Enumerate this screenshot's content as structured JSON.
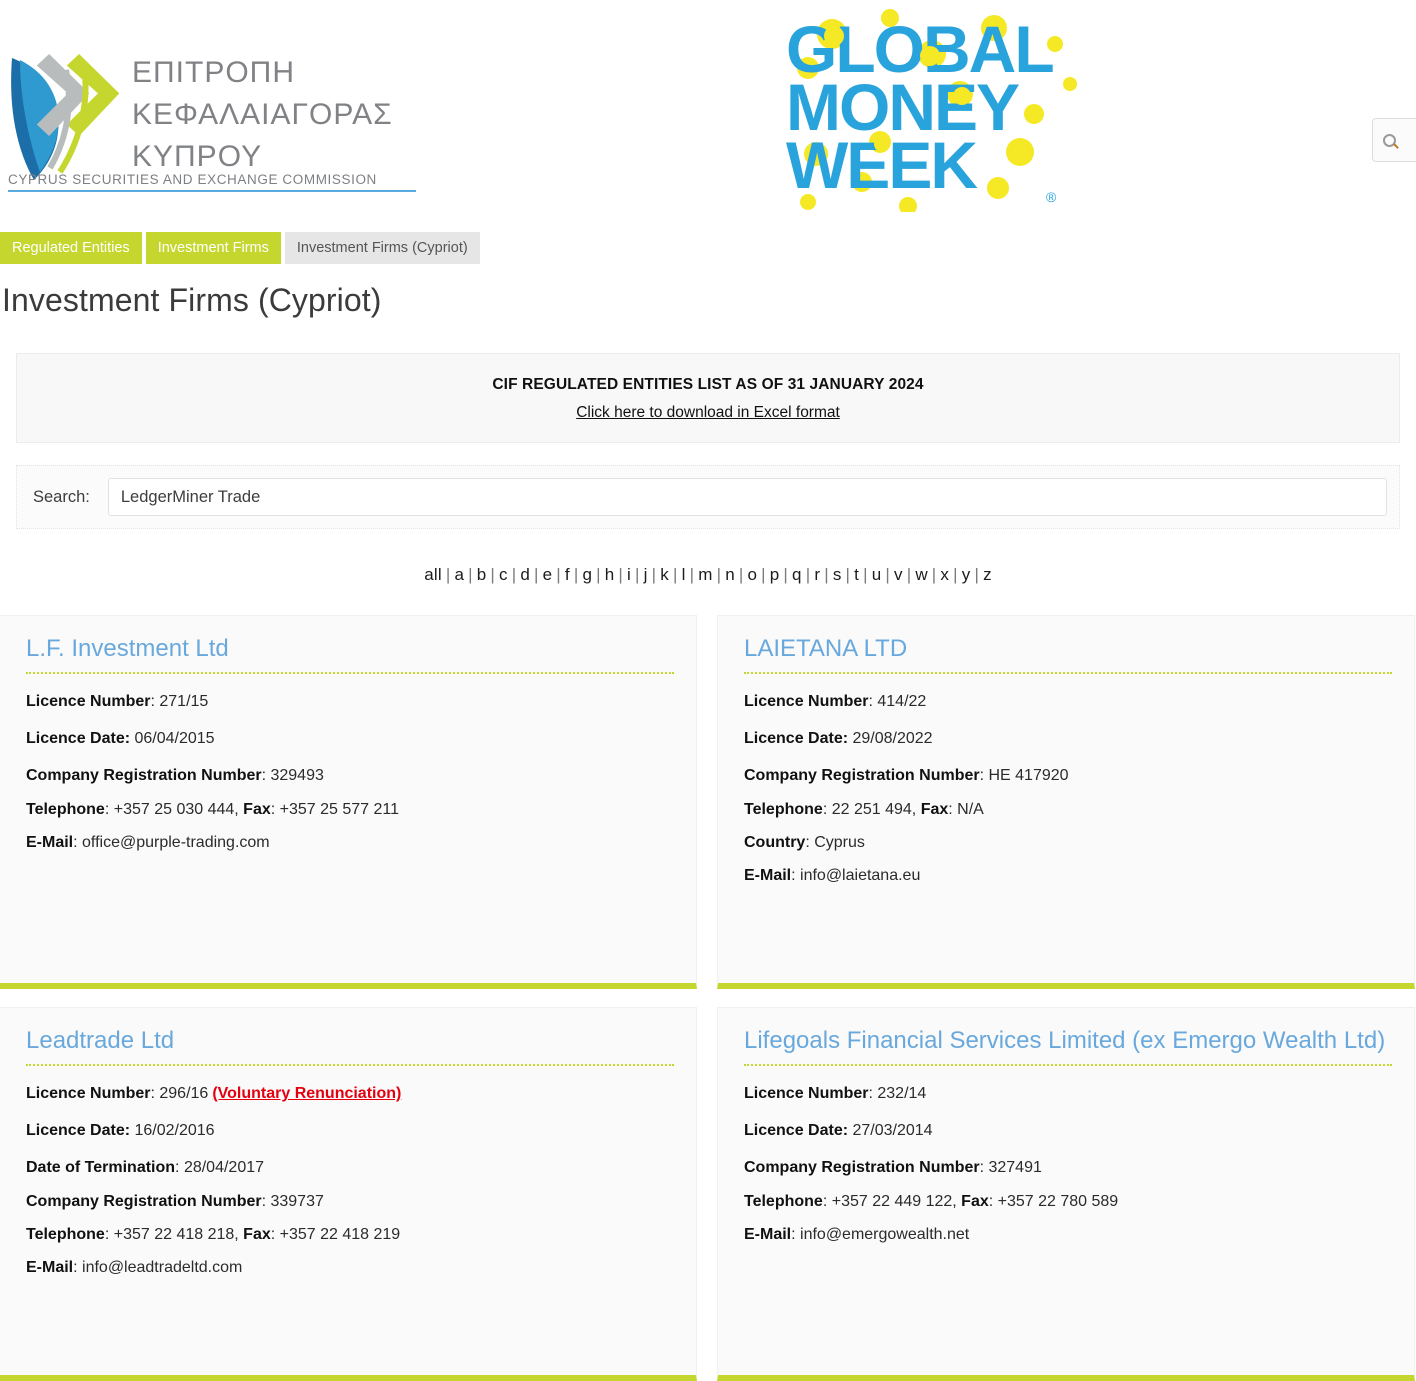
{
  "header": {
    "cysec_logo_line1": "ΕΠΙΤΡΟΠΗ",
    "cysec_logo_line2": "ΚΕΦΑΛΑΙΑΓΟΡΑΣ",
    "cysec_logo_line3": "ΚΥΠΡΟΥ",
    "cysec_logo_subtitle": "CYPRUS SECURITIES AND EXCHANGE COMMISSION",
    "gmw_logo_line1": "GLOBAL",
    "gmw_logo_line2": "MONEY",
    "gmw_logo_line3": "WEEK",
    "gmw_registered_mark": "®",
    "top_search_icon": "search-icon"
  },
  "breadcrumb": [
    {
      "label": "Regulated Entities",
      "current": false
    },
    {
      "label": "Investment Firms",
      "current": false
    },
    {
      "label": "Investment Firms (Cypriot)",
      "current": true
    }
  ],
  "page_title": "Investment Firms (Cypriot)",
  "notice": {
    "title": "CIF REGULATED ENTITIES LIST AS OF 31 JANUARY 2024",
    "link": "Click here to download in Excel format"
  },
  "search": {
    "label": "Search:",
    "value": "LedgerMiner Trade",
    "placeholder": ""
  },
  "alphabet": {
    "all": "all",
    "letters": [
      "a",
      "b",
      "c",
      "d",
      "e",
      "f",
      "g",
      "h",
      "i",
      "j",
      "k",
      "l",
      "m",
      "n",
      "o",
      "p",
      "q",
      "r",
      "s",
      "t",
      "u",
      "v",
      "w",
      "x",
      "y",
      "z"
    ],
    "separator": "|"
  },
  "labels": {
    "licence_number": "Licence Number",
    "licence_date": "Licence Date:",
    "date_of_termination": "Date of Termination",
    "company_registration_number": "Company Registration Number",
    "telephone": "Telephone",
    "fax": "Fax",
    "country": "Country",
    "email": "E-Mail"
  },
  "colors": {
    "accent_green": "#c5d72e",
    "title_blue": "#68a8dc",
    "alert_red": "#e3000f",
    "card_bg": "#fafafa"
  },
  "cards": [
    {
      "name": "L.F. Investment Ltd",
      "licence_number": "271/15",
      "status_note": "",
      "licence_date": "06/04/2015",
      "date_of_termination": "",
      "company_registration_number": "329493",
      "telephone": "+357 25 030 444",
      "fax": "+357 25 577 211",
      "country": "",
      "email": "office@purple-trading.com"
    },
    {
      "name": "LAIETANA LTD",
      "licence_number": "414/22",
      "status_note": "",
      "licence_date": "29/08/2022",
      "date_of_termination": "",
      "company_registration_number": "HE 417920",
      "telephone": "22 251 494",
      "fax": "N/A",
      "country": "Cyprus",
      "email": "info@laietana.eu"
    },
    {
      "name": "Leadtrade Ltd",
      "licence_number": "296/16",
      "status_note": "(Voluntary Renunciation)",
      "licence_date": "16/02/2016",
      "date_of_termination": "28/04/2017",
      "company_registration_number": "339737",
      "telephone": "+357 22 418 218",
      "fax": "+357 22 418 219",
      "country": "",
      "email": "info@leadtradeltd.com"
    },
    {
      "name": "Lifegoals Financial Services Limited (ex Emergo Wealth Ltd)",
      "licence_number": "232/14",
      "status_note": "",
      "licence_date": "27/03/2014",
      "date_of_termination": "",
      "company_registration_number": "327491",
      "telephone": "+357 22 449 122",
      "fax": "+357 22 780 589",
      "country": "",
      "email": "info@emergowealth.net"
    }
  ]
}
